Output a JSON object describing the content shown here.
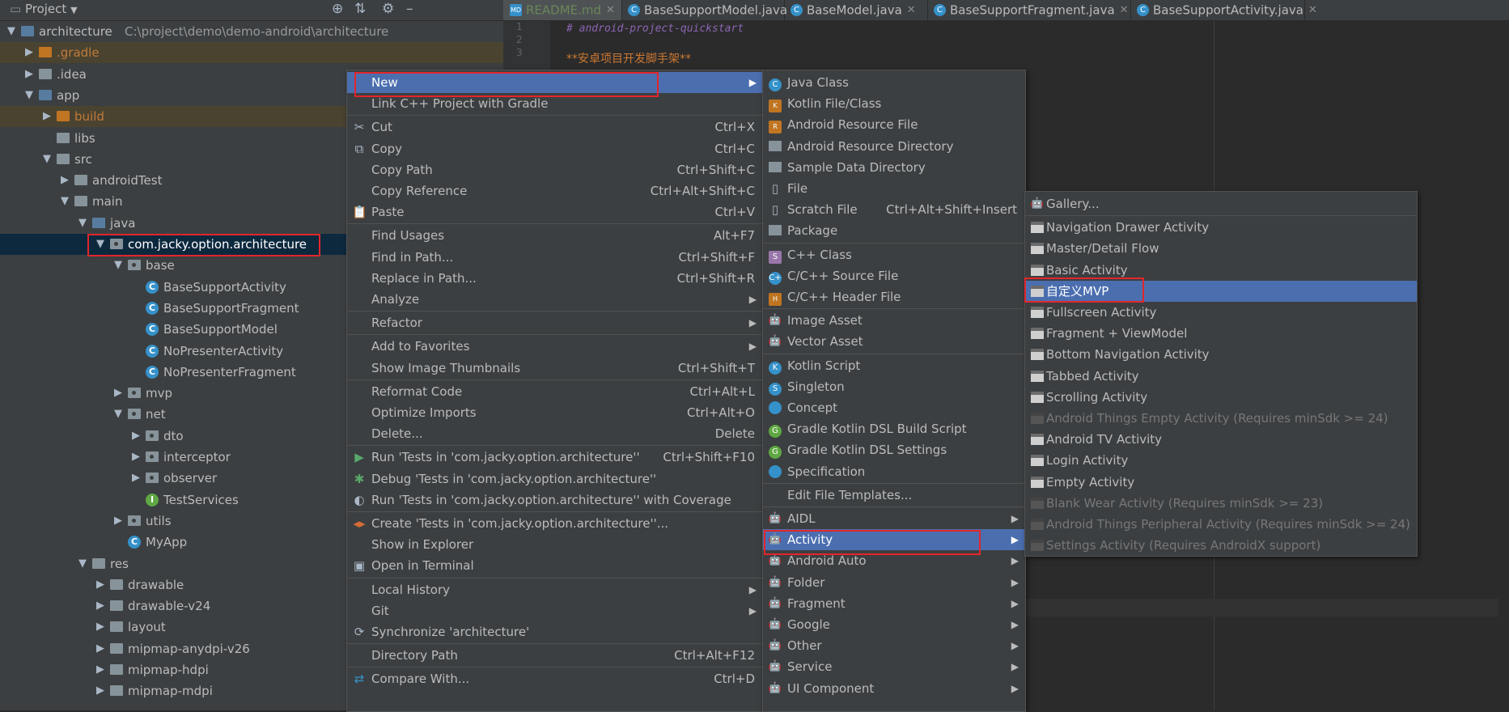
{
  "project_panel": {
    "title": "Project",
    "tree": [
      {
        "label": "architecture",
        "path": "C:\\project\\demo\\demo-android\\architecture",
        "indent": 0,
        "arrow": "down",
        "icon": "module"
      },
      {
        "label": ".gradle",
        "indent": 1,
        "arrow": "right",
        "icon": "folder-orange",
        "style": "excluded"
      },
      {
        "label": ".idea",
        "indent": 1,
        "arrow": "right",
        "icon": "folder"
      },
      {
        "label": "app",
        "indent": 1,
        "arrow": "down",
        "icon": "module"
      },
      {
        "label": "build",
        "indent": 2,
        "arrow": "right",
        "icon": "folder-orange",
        "style": "excluded"
      },
      {
        "label": "libs",
        "indent": 2,
        "arrow": "",
        "icon": "folder"
      },
      {
        "label": "src",
        "indent": 2,
        "arrow": "down",
        "icon": "folder"
      },
      {
        "label": "androidTest",
        "indent": 3,
        "arrow": "right",
        "icon": "folder"
      },
      {
        "label": "main",
        "indent": 3,
        "arrow": "down",
        "icon": "folder"
      },
      {
        "label": "java",
        "indent": 4,
        "arrow": "down",
        "icon": "folder-blue"
      },
      {
        "label": "com.jacky.option.architecture",
        "indent": 5,
        "arrow": "down",
        "icon": "package",
        "style": "selected"
      },
      {
        "label": "base",
        "indent": 6,
        "arrow": "down",
        "icon": "package"
      },
      {
        "label": "BaseSupportActivity",
        "indent": 7,
        "arrow": "",
        "icon": "class"
      },
      {
        "label": "BaseSupportFragment",
        "indent": 7,
        "arrow": "",
        "icon": "class"
      },
      {
        "label": "BaseSupportModel",
        "indent": 7,
        "arrow": "",
        "icon": "class"
      },
      {
        "label": "NoPresenterActivity",
        "indent": 7,
        "arrow": "",
        "icon": "class"
      },
      {
        "label": "NoPresenterFragment",
        "indent": 7,
        "arrow": "",
        "icon": "class"
      },
      {
        "label": "mvp",
        "indent": 6,
        "arrow": "right",
        "icon": "package"
      },
      {
        "label": "net",
        "indent": 6,
        "arrow": "down",
        "icon": "package"
      },
      {
        "label": "dto",
        "indent": 7,
        "arrow": "right",
        "icon": "package"
      },
      {
        "label": "interceptor",
        "indent": 7,
        "arrow": "right",
        "icon": "package"
      },
      {
        "label": "observer",
        "indent": 7,
        "arrow": "right",
        "icon": "package"
      },
      {
        "label": "TestServices",
        "indent": 7,
        "arrow": "",
        "icon": "interface"
      },
      {
        "label": "utils",
        "indent": 6,
        "arrow": "right",
        "icon": "package"
      },
      {
        "label": "MyApp",
        "indent": 6,
        "arrow": "",
        "icon": "class"
      },
      {
        "label": "res",
        "indent": 4,
        "arrow": "down",
        "icon": "folder"
      },
      {
        "label": "drawable",
        "indent": 5,
        "arrow": "right",
        "icon": "folder"
      },
      {
        "label": "drawable-v24",
        "indent": 5,
        "arrow": "right",
        "icon": "folder"
      },
      {
        "label": "layout",
        "indent": 5,
        "arrow": "right",
        "icon": "folder"
      },
      {
        "label": "mipmap-anydpi-v26",
        "indent": 5,
        "arrow": "right",
        "icon": "folder"
      },
      {
        "label": "mipmap-hdpi",
        "indent": 5,
        "arrow": "right",
        "icon": "folder"
      },
      {
        "label": "mipmap-mdpi",
        "indent": 5,
        "arrow": "right",
        "icon": "folder"
      }
    ]
  },
  "tabs": [
    {
      "label": "README.md",
      "icon": "MD",
      "active": true
    },
    {
      "label": "BaseSupportModel.java",
      "icon": "C"
    },
    {
      "label": "BaseModel.java",
      "icon": "C"
    },
    {
      "label": "BaseSupportFragment.java",
      "icon": "C"
    },
    {
      "label": "BaseSupportActivity.java",
      "icon": "C"
    }
  ],
  "editor": {
    "line_numbers": [
      "1",
      "2",
      "3"
    ],
    "line1": "# android-project-quickstart",
    "line3": "**安卓项目开发脚手架**"
  },
  "context_menu": {
    "items": [
      {
        "label": "New",
        "submenu": true,
        "highlight": true
      },
      {
        "label": "Link C++ Project with Gradle"
      },
      {
        "sep": true
      },
      {
        "label": "Cut",
        "shortcut": "Ctrl+X",
        "icon": "✂"
      },
      {
        "label": "Copy",
        "shortcut": "Ctrl+C",
        "icon": "⧉"
      },
      {
        "label": "Copy Path",
        "shortcut": "Ctrl+Shift+C"
      },
      {
        "label": "Copy Reference",
        "shortcut": "Ctrl+Alt+Shift+C"
      },
      {
        "label": "Paste",
        "shortcut": "Ctrl+V",
        "icon": "📋"
      },
      {
        "sep": true
      },
      {
        "label": "Find Usages",
        "shortcut": "Alt+F7"
      },
      {
        "label": "Find in Path...",
        "shortcut": "Ctrl+Shift+F"
      },
      {
        "label": "Replace in Path...",
        "shortcut": "Ctrl+Shift+R"
      },
      {
        "label": "Analyze",
        "submenu": true
      },
      {
        "sep": true
      },
      {
        "label": "Refactor",
        "submenu": true
      },
      {
        "sep": true
      },
      {
        "label": "Add to Favorites",
        "submenu": true
      },
      {
        "label": "Show Image Thumbnails",
        "shortcut": "Ctrl+Shift+T"
      },
      {
        "sep": true
      },
      {
        "label": "Reformat Code",
        "shortcut": "Ctrl+Alt+L"
      },
      {
        "label": "Optimize Imports",
        "shortcut": "Ctrl+Alt+O"
      },
      {
        "label": "Delete...",
        "shortcut": "Delete"
      },
      {
        "sep": true
      },
      {
        "label": "Run 'Tests in 'com.jacky.option.architecture''",
        "shortcut": "Ctrl+Shift+F10",
        "icon": "▶",
        "iconcolor": "#59a869"
      },
      {
        "label": "Debug 'Tests in 'com.jacky.option.architecture''",
        "icon": "✱",
        "iconcolor": "#59a869"
      },
      {
        "label": "Run 'Tests in 'com.jacky.option.architecture'' with Coverage",
        "icon": "◐"
      },
      {
        "sep": true
      },
      {
        "label": "Create 'Tests in 'com.jacky.option.architecture''...",
        "icon": "◂▸",
        "iconcolor": "#d86b36"
      },
      {
        "label": "Show in Explorer"
      },
      {
        "label": "Open in Terminal",
        "icon": "▣"
      },
      {
        "sep": true
      },
      {
        "label": "Local History",
        "submenu": true
      },
      {
        "label": "Git",
        "submenu": true
      },
      {
        "label": "Synchronize 'architecture'",
        "icon": "⟳"
      },
      {
        "sep": true
      },
      {
        "label": "Directory Path",
        "shortcut": "Ctrl+Alt+F12"
      },
      {
        "sep": true
      },
      {
        "label": "Compare With...",
        "shortcut": "Ctrl+D",
        "icon": "⇄",
        "iconcolor": "#3591c9"
      }
    ]
  },
  "new_menu": {
    "items": [
      {
        "label": "Java Class",
        "icon": "C",
        "itype": "c"
      },
      {
        "label": "Kotlin File/Class",
        "icon": "K",
        "itype": "k"
      },
      {
        "label": "Android Resource File",
        "icon": "R",
        "itype": "k"
      },
      {
        "label": "Android Resource Directory",
        "icon": "",
        "itype": "f"
      },
      {
        "label": "Sample Data Directory",
        "icon": "",
        "itype": "f"
      },
      {
        "label": "File",
        "icon": "",
        "itype": "file"
      },
      {
        "label": "Scratch File",
        "shortcut": "Ctrl+Alt+Shift+Insert",
        "icon": "",
        "itype": "file"
      },
      {
        "label": "Package",
        "icon": "",
        "itype": "f"
      },
      {
        "sep": true
      },
      {
        "label": "C++ Class",
        "icon": "S",
        "itype": "s"
      },
      {
        "label": "C/C++ Source File",
        "icon": "C+",
        "itype": "c"
      },
      {
        "label": "C/C++ Header File",
        "icon": "H",
        "itype": "k"
      },
      {
        "sep": true
      },
      {
        "label": "Image Asset",
        "icon": "",
        "itype": "android"
      },
      {
        "label": "Vector Asset",
        "icon": "",
        "itype": "android"
      },
      {
        "sep": true
      },
      {
        "label": "Kotlin Script",
        "icon": "K",
        "itype": "c"
      },
      {
        "label": "Singleton",
        "icon": "S",
        "itype": "c"
      },
      {
        "label": "Concept",
        "icon": "",
        "itype": "c"
      },
      {
        "label": "Gradle Kotlin DSL Build Script",
        "icon": "G",
        "itype": "g"
      },
      {
        "label": "Gradle Kotlin DSL Settings",
        "icon": "G",
        "itype": "g"
      },
      {
        "label": "Specification",
        "icon": "",
        "itype": "c"
      },
      {
        "sep": true
      },
      {
        "label": "Edit File Templates..."
      },
      {
        "sep": true
      },
      {
        "label": "AIDL",
        "submenu": true,
        "itype": "android"
      },
      {
        "label": "Activity",
        "submenu": true,
        "itype": "android",
        "highlight": true
      },
      {
        "label": "Android Auto",
        "submenu": true,
        "itype": "android"
      },
      {
        "label": "Folder",
        "submenu": true,
        "itype": "android"
      },
      {
        "label": "Fragment",
        "submenu": true,
        "itype": "android"
      },
      {
        "label": "Google",
        "submenu": true,
        "itype": "android"
      },
      {
        "label": "Other",
        "submenu": true,
        "itype": "android"
      },
      {
        "label": "Service",
        "submenu": true,
        "itype": "android"
      },
      {
        "label": "UI Component",
        "submenu": true,
        "itype": "android"
      }
    ]
  },
  "activity_menu": {
    "items": [
      {
        "label": "Gallery...",
        "itype": "android"
      },
      {
        "sep": true
      },
      {
        "label": "Navigation Drawer Activity",
        "itype": "act"
      },
      {
        "label": "Master/Detail Flow",
        "itype": "act"
      },
      {
        "label": "Basic Activity",
        "itype": "act"
      },
      {
        "label": "自定义MVP",
        "itype": "act",
        "highlight": true
      },
      {
        "label": "Fullscreen Activity",
        "itype": "act"
      },
      {
        "label": "Fragment + ViewModel",
        "itype": "act"
      },
      {
        "label": "Bottom Navigation Activity",
        "itype": "act"
      },
      {
        "label": "Tabbed Activity",
        "itype": "act"
      },
      {
        "label": "Scrolling Activity",
        "itype": "act"
      },
      {
        "label": "Android Things Empty Activity (Requires minSdk >= 24)",
        "itype": "act",
        "disabled": true
      },
      {
        "label": "Android TV Activity",
        "itype": "act"
      },
      {
        "label": "Login Activity",
        "itype": "act"
      },
      {
        "label": "Empty Activity",
        "itype": "act"
      },
      {
        "label": "Blank Wear Activity (Requires minSdk >= 23)",
        "itype": "act",
        "disabled": true
      },
      {
        "label": "Android Things Peripheral Activity (Requires minSdk >= 24)",
        "itype": "act",
        "disabled": true
      },
      {
        "label": "Settings Activity (Requires AndroidX support)",
        "itype": "act",
        "disabled": true
      }
    ]
  }
}
